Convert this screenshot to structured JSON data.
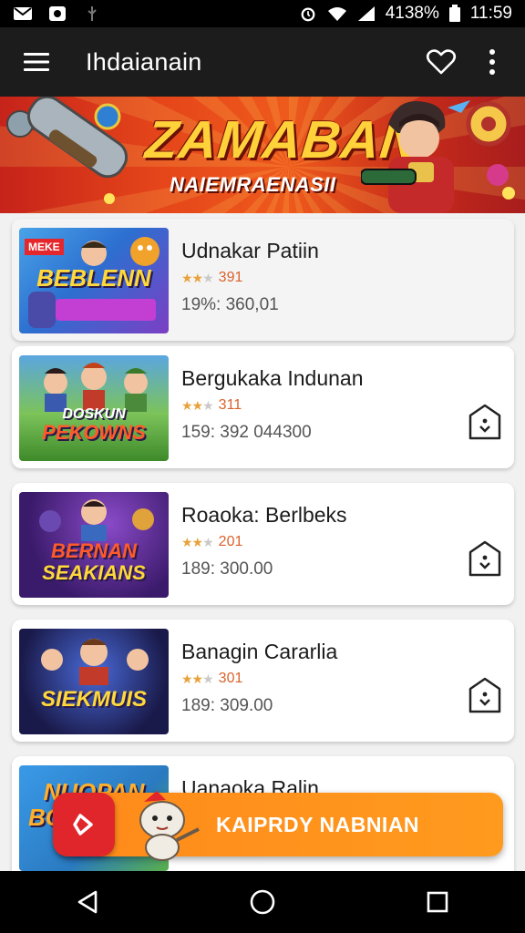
{
  "status_bar": {
    "battery_text": "4138%",
    "time": "11:59",
    "icons": [
      "mail-icon",
      "notification-icon",
      "usb-icon",
      "alarm-icon",
      "wifi-icon",
      "signal-icon",
      "battery-icon"
    ]
  },
  "app_bar": {
    "title": "Ihdaianain",
    "icons": [
      "hamburger-menu-icon",
      "heart-icon",
      "more-vertical-icon"
    ]
  },
  "banner": {
    "title": "ZAMABAN",
    "subtitle": "NAIEMRAENASII"
  },
  "items": [
    {
      "name": "Udnakar Patiin",
      "rating": "391",
      "stars": 2,
      "meta": "19%: 360,01",
      "thumb_text": "BEBLENN",
      "thumb_badge": "MEKE",
      "has_download": false
    },
    {
      "name": "Bergukaka Indunan",
      "rating": "311",
      "stars": 2,
      "meta": "159: 392 044300",
      "thumb_text": "PEKOWNS",
      "thumb_badge": "DOSKUN",
      "has_download": true
    },
    {
      "name": "Roaoka: Berlbeks",
      "rating": "201",
      "stars": 2,
      "meta": "189: 300.00",
      "thumb_text": "SEAKIANS",
      "thumb_badge": "BERNAN",
      "has_download": true
    },
    {
      "name": "Banagin Cararlia",
      "rating": "301",
      "stars": 2,
      "meta": "189: 309.00",
      "thumb_text": "SIEKMUIS",
      "thumb_badge": "",
      "has_download": true
    },
    {
      "name": "Uanaoka Ralin",
      "rating": "",
      "stars": 0,
      "meta": "",
      "thumb_text": "NUOPAN",
      "thumb_badge": "BO",
      "has_download": false
    }
  ],
  "cta": {
    "label": "KAIPRDY NABNIAN"
  },
  "colors": {
    "app_bar_bg": "#1c1c1c",
    "accent_orange": "#ff8a1a",
    "accent_red": "#e0262b",
    "banner_red": "#e5451a",
    "star": "#e8a23a"
  },
  "nav_bar": {
    "icons": [
      "back-icon",
      "home-icon",
      "recents-icon"
    ]
  }
}
